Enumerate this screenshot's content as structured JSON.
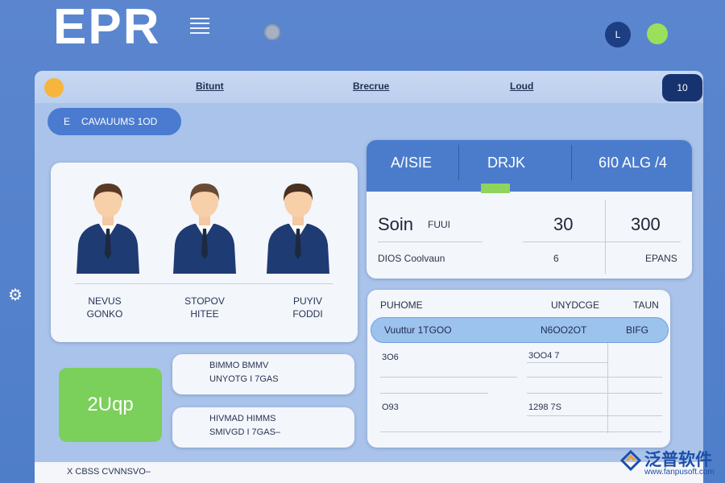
{
  "brand": "EPR",
  "header": {
    "user_badge": "L"
  },
  "topbar": {
    "tabs": [
      "Bitunt",
      "Brecrue",
      "Loud"
    ],
    "right_button": "10"
  },
  "pill": {
    "icon": "E",
    "label": "CAVAUUMS 1OD"
  },
  "people": [
    {
      "line1": "NEVUS",
      "line2": "GONKO"
    },
    {
      "line1": "STOPOV",
      "line2": "HITEE"
    },
    {
      "line1": "PUYIV",
      "line2": "FODDI"
    }
  ],
  "green_card": {
    "value": "2Uqp"
  },
  "info_cards": [
    {
      "line1": "BIMMO BMMV",
      "line2": "UNYOTG I 7GAS"
    },
    {
      "line1": "HIVMAD HIMMS",
      "line2": "SMIVGD I 7GAS–"
    }
  ],
  "stats": {
    "headers": [
      "A/ISIE",
      "DRJK",
      "6I0 ALG /4"
    ],
    "row1": {
      "label": "Soin",
      "sub": "FUUI",
      "v1": "30",
      "v2": "300"
    },
    "row2": {
      "label": "DIOS Coolvaun",
      "v1": "6",
      "v2": "EPANS"
    }
  },
  "table": {
    "headers": [
      "PUHOME",
      "UNYDCGE",
      "TAUN"
    ],
    "highlight_row": [
      "Vuuttur 1TGOO",
      "N6OO2OT",
      "BIFG"
    ],
    "rows": [
      [
        "3O6",
        "3OO4 7"
      ],
      [
        "O93",
        "1298 7S"
      ]
    ]
  },
  "footer": {
    "text": "X CBSS CVNNSVO–"
  },
  "watermark": {
    "text": "泛普软件",
    "url": "www.fanpusoft.com"
  },
  "colors": {
    "accent": "#4b7ccc",
    "dark": "#17336f",
    "green": "#7bcf5b",
    "orange": "#f7b53d"
  }
}
